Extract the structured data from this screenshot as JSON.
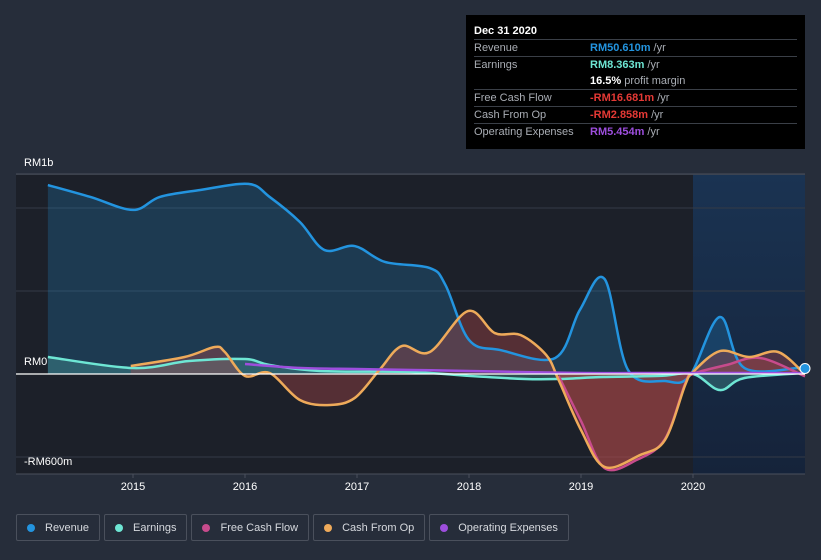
{
  "tooltip": {
    "date": "Dec 31 2020",
    "rows": [
      {
        "label": "Revenue",
        "value": "RM50.610m",
        "unit": "/yr",
        "color": "#2394df"
      },
      {
        "label": "Earnings",
        "value": "RM8.363m",
        "unit": "/yr",
        "color": "#6ee6d4"
      },
      {
        "label": "",
        "value": "16.5%",
        "unit": "profit margin",
        "color": "#ffffff"
      },
      {
        "label": "Free Cash Flow",
        "value": "-RM16.681m",
        "unit": "/yr",
        "color": "#e53935"
      },
      {
        "label": "Cash From Op",
        "value": "-RM2.858m",
        "unit": "/yr",
        "color": "#e53935"
      },
      {
        "label": "Operating Expenses",
        "value": "RM5.454m",
        "unit": "/yr",
        "color": "#9d4edd"
      }
    ]
  },
  "legend": [
    {
      "label": "Revenue",
      "color": "#2394df"
    },
    {
      "label": "Earnings",
      "color": "#6ee6d4"
    },
    {
      "label": "Free Cash Flow",
      "color": "#c74b8c"
    },
    {
      "label": "Cash From Op",
      "color": "#eeaa5a"
    },
    {
      "label": "Operating Expenses",
      "color": "#9d4edd"
    }
  ],
  "chart_data": {
    "type": "area",
    "title": "",
    "xlabel": "",
    "ylabel": "",
    "unit": "RM m",
    "y_labels": [
      {
        "text": "RM1b",
        "value": 1443
      },
      {
        "text": "RM0",
        "value": 0
      },
      {
        "text": "-RM600m",
        "value": -600
      }
    ],
    "ylim": [
      -730,
      1443
    ],
    "xlim": [
      2013.95,
      2020.98
    ],
    "x_ticks": [
      "2015",
      "2016",
      "2017",
      "2018",
      "2019",
      "2020"
    ],
    "forecast_start": 2020.0,
    "grid": true,
    "legend_position": "bottom",
    "series": [
      {
        "name": "Revenue",
        "color": "#2394df",
        "points": [
          [
            2014.24,
            1366
          ],
          [
            2014.62,
            1280
          ],
          [
            2015.0,
            1186
          ],
          [
            2015.24,
            1280
          ],
          [
            2015.6,
            1330
          ],
          [
            2016.03,
            1374
          ],
          [
            2016.22,
            1280
          ],
          [
            2016.49,
            1099
          ],
          [
            2016.71,
            896
          ],
          [
            2016.98,
            925
          ],
          [
            2017.25,
            810
          ],
          [
            2017.65,
            766
          ],
          [
            2017.79,
            643
          ],
          [
            2018.0,
            246
          ],
          [
            2018.28,
            173
          ],
          [
            2018.77,
            116
          ],
          [
            2018.99,
            463
          ],
          [
            2019.21,
            687
          ],
          [
            2019.42,
            29
          ],
          [
            2019.75,
            -51
          ],
          [
            2019.97,
            -14
          ],
          [
            2020.24,
            412
          ],
          [
            2020.46,
            43
          ],
          [
            2021.0,
            51
          ]
        ]
      },
      {
        "name": "Earnings",
        "color": "#6ee6d4",
        "points": [
          [
            2014.24,
            123
          ],
          [
            2015.0,
            43
          ],
          [
            2015.5,
            94
          ],
          [
            2016.0,
            108
          ],
          [
            2016.22,
            65
          ],
          [
            2016.67,
            22
          ],
          [
            2017.5,
            14
          ],
          [
            2018.0,
            -14
          ],
          [
            2018.5,
            -36
          ],
          [
            2018.8,
            -36
          ],
          [
            2019.2,
            -22
          ],
          [
            2019.7,
            -14
          ],
          [
            2020.0,
            0
          ],
          [
            2020.24,
            -116
          ],
          [
            2020.46,
            -29
          ],
          [
            2021.0,
            8
          ]
        ]
      },
      {
        "name": "Free Cash Flow",
        "color": "#c74b8c",
        "points": [
          [
            2018.8,
            -14
          ],
          [
            2019.0,
            -340
          ],
          [
            2019.21,
            -680
          ],
          [
            2019.5,
            -620
          ],
          [
            2019.75,
            -470
          ],
          [
            2019.93,
            -70
          ],
          [
            2020.0,
            0
          ],
          [
            2020.3,
            65
          ],
          [
            2020.6,
            116
          ],
          [
            2021.0,
            -17
          ]
        ]
      },
      {
        "name": "Cash From Op",
        "color": "#eeaa5a",
        "points": [
          [
            2014.98,
            58
          ],
          [
            2015.46,
            123
          ],
          [
            2015.73,
            195
          ],
          [
            2015.82,
            159
          ],
          [
            2016.0,
            -14
          ],
          [
            2016.22,
            7
          ],
          [
            2016.49,
            -188
          ],
          [
            2016.76,
            -224
          ],
          [
            2016.98,
            -173
          ],
          [
            2017.2,
            29
          ],
          [
            2017.4,
            202
          ],
          [
            2017.65,
            159
          ],
          [
            2017.99,
            455
          ],
          [
            2018.23,
            296
          ],
          [
            2018.46,
            282
          ],
          [
            2018.69,
            137
          ],
          [
            2018.8,
            -43
          ],
          [
            2019.0,
            -405
          ],
          [
            2019.21,
            -672
          ],
          [
            2019.53,
            -585
          ],
          [
            2019.75,
            -477
          ],
          [
            2019.93,
            -80
          ],
          [
            2020.0,
            14
          ],
          [
            2020.24,
            166
          ],
          [
            2020.5,
            123
          ],
          [
            2020.76,
            159
          ],
          [
            2021.0,
            -3
          ]
        ]
      },
      {
        "name": "Operating Expenses",
        "color": "#9d4edd",
        "points": [
          [
            2016.0,
            72
          ],
          [
            2016.5,
            43
          ],
          [
            2017.0,
            36
          ],
          [
            2017.5,
            29
          ],
          [
            2018.0,
            22
          ],
          [
            2018.5,
            14
          ],
          [
            2019.0,
            7
          ],
          [
            2019.5,
            7
          ],
          [
            2020.0,
            7
          ],
          [
            2020.5,
            7
          ],
          [
            2021.0,
            5
          ]
        ]
      }
    ]
  }
}
